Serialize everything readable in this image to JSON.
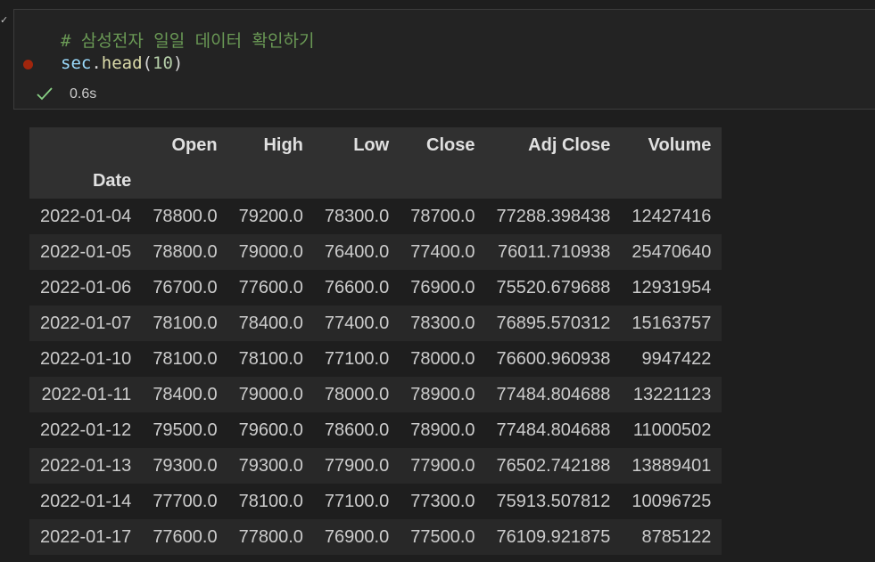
{
  "code": {
    "comment": "# 삼성전자 일일 데이터 확인하기",
    "line2": {
      "var": "sec",
      "dot": ".",
      "fn": "head",
      "open": "(",
      "arg": "10",
      "close": ")"
    }
  },
  "status": {
    "icon": "check-icon",
    "time": "0.6s"
  },
  "table": {
    "columns": [
      "Open",
      "High",
      "Low",
      "Close",
      "Adj Close",
      "Volume"
    ],
    "index_name": "Date",
    "rows": [
      {
        "date": "2022-01-04",
        "values": [
          "78800.0",
          "79200.0",
          "78300.0",
          "78700.0",
          "77288.398438",
          "12427416"
        ]
      },
      {
        "date": "2022-01-05",
        "values": [
          "78800.0",
          "79000.0",
          "76400.0",
          "77400.0",
          "76011.710938",
          "25470640"
        ]
      },
      {
        "date": "2022-01-06",
        "values": [
          "76700.0",
          "77600.0",
          "76600.0",
          "76900.0",
          "75520.679688",
          "12931954"
        ]
      },
      {
        "date": "2022-01-07",
        "values": [
          "78100.0",
          "78400.0",
          "77400.0",
          "78300.0",
          "76895.570312",
          "15163757"
        ]
      },
      {
        "date": "2022-01-10",
        "values": [
          "78100.0",
          "78100.0",
          "77100.0",
          "78000.0",
          "76600.960938",
          "9947422"
        ]
      },
      {
        "date": "2022-01-11",
        "values": [
          "78400.0",
          "79000.0",
          "78000.0",
          "78900.0",
          "77484.804688",
          "13221123"
        ]
      },
      {
        "date": "2022-01-12",
        "values": [
          "79500.0",
          "79600.0",
          "78600.0",
          "78900.0",
          "77484.804688",
          "11000502"
        ]
      },
      {
        "date": "2022-01-13",
        "values": [
          "79300.0",
          "79300.0",
          "77900.0",
          "77900.0",
          "76502.742188",
          "13889401"
        ]
      },
      {
        "date": "2022-01-14",
        "values": [
          "77700.0",
          "78100.0",
          "77100.0",
          "77300.0",
          "75913.507812",
          "10096725"
        ]
      },
      {
        "date": "2022-01-17",
        "values": [
          "77600.0",
          "77800.0",
          "76900.0",
          "77500.0",
          "76109.921875",
          "8785122"
        ]
      }
    ]
  }
}
